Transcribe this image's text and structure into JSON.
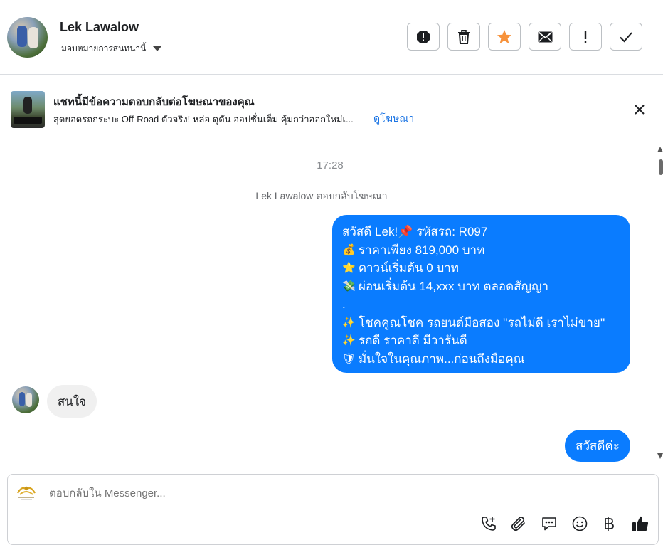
{
  "header": {
    "contact_name": "Lek Lawalow",
    "assign_label": "มอบหมายการสนทนานี้",
    "actions": [
      {
        "name": "spam-icon",
        "label": "spam"
      },
      {
        "name": "trash-icon",
        "label": "delete"
      },
      {
        "name": "star-icon",
        "label": "star"
      },
      {
        "name": "envelope-icon",
        "label": "mark unread"
      },
      {
        "name": "exclamation-icon",
        "label": "follow up"
      },
      {
        "name": "checkmark-icon",
        "label": "done"
      }
    ],
    "star_color": "#f7923b"
  },
  "ad_banner": {
    "title": "แชทนี้มีข้อความตอบกลับต่อโฆษณาของคุณ",
    "description": "สุดยอดรถกระบะ Off-Road ตัวจริง! หล่อ ดุดัน ออปชั่นเต็ม คุ้มกว่าออกใหม่เ...",
    "link_label": "ดูโฆษณา"
  },
  "chat": {
    "timestamp": "17:28",
    "reply_note": "Lek Lawalow ตอบกลับโฆษณา",
    "outgoing_message": {
      "lines": [
        {
          "emoji": "",
          "text": "สวัสดี Lek!📌 รหัสรถ: R097"
        },
        {
          "emoji": "💰",
          "text": "ราคาเพียง 819,000 บาท"
        },
        {
          "emoji": "⭐",
          "text": "ดาวน์เริ่มต้น 0 บาท"
        },
        {
          "emoji": "💸",
          "text": "ผ่อนเริ่มต้น 14,xxx บาท ตลอดสัญญา"
        },
        {
          "emoji": "",
          "text": "."
        },
        {
          "emoji": "✨",
          "text": "โชคคูณโชค รถยนต์มือสอง ''รถไม่ดี เราไม่ขาย''"
        },
        {
          "emoji": "✨",
          "text": "รถดี ราคาดี มีวารันตี"
        },
        {
          "emoji": "🛡",
          "text": "มั่นใจในคุณภาพ...ก่อนถึงมือคุณ"
        }
      ]
    },
    "incoming_message": "สนใจ",
    "outgoing_short": "สวัสดีค่ะ",
    "bubble_color": "#0a7cff"
  },
  "composer": {
    "placeholder": "ตอบกลับใน Messenger...",
    "tools": [
      "phone-add-icon",
      "paperclip-icon",
      "chat-bubble-icon",
      "smiley-icon",
      "baht-icon",
      "thumbs-up-icon"
    ]
  }
}
